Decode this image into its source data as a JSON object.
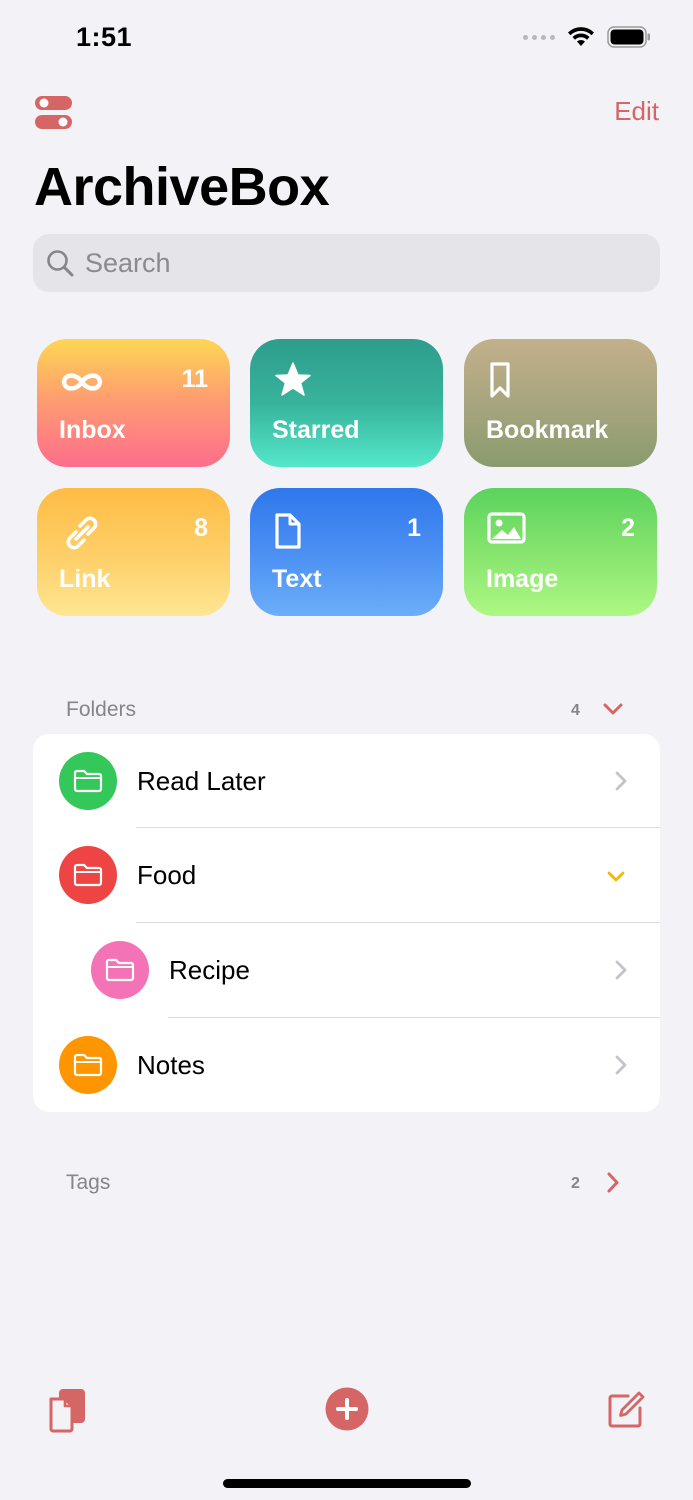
{
  "status_bar": {
    "time": "1:51"
  },
  "header": {
    "edit_label": "Edit",
    "title": "ArchiveBox"
  },
  "search": {
    "placeholder": "Search",
    "value": ""
  },
  "categories": [
    {
      "label": "Inbox",
      "count": "11",
      "icon": "infinity-icon"
    },
    {
      "label": "Starred",
      "count": "",
      "icon": "star-icon"
    },
    {
      "label": "Bookmark",
      "count": "",
      "icon": "bookmark-icon"
    },
    {
      "label": "Link",
      "count": "8",
      "icon": "link-icon"
    },
    {
      "label": "Text",
      "count": "1",
      "icon": "document-icon"
    },
    {
      "label": "Image",
      "count": "2",
      "icon": "photo-icon"
    }
  ],
  "folders": {
    "title": "Folders",
    "count": "4",
    "items": [
      {
        "label": "Read Later",
        "color": "#34c759",
        "chevron": "right"
      },
      {
        "label": "Food",
        "color": "#ee4444",
        "chevron": "down"
      },
      {
        "label": "Recipe",
        "color": "#f472b6",
        "chevron": "right"
      },
      {
        "label": "Notes",
        "color": "#ff9500",
        "chevron": "right"
      }
    ]
  },
  "tags": {
    "title": "Tags",
    "count": "2"
  },
  "colors": {
    "accent": "#d66565",
    "expand_accent": "#f5b800"
  }
}
